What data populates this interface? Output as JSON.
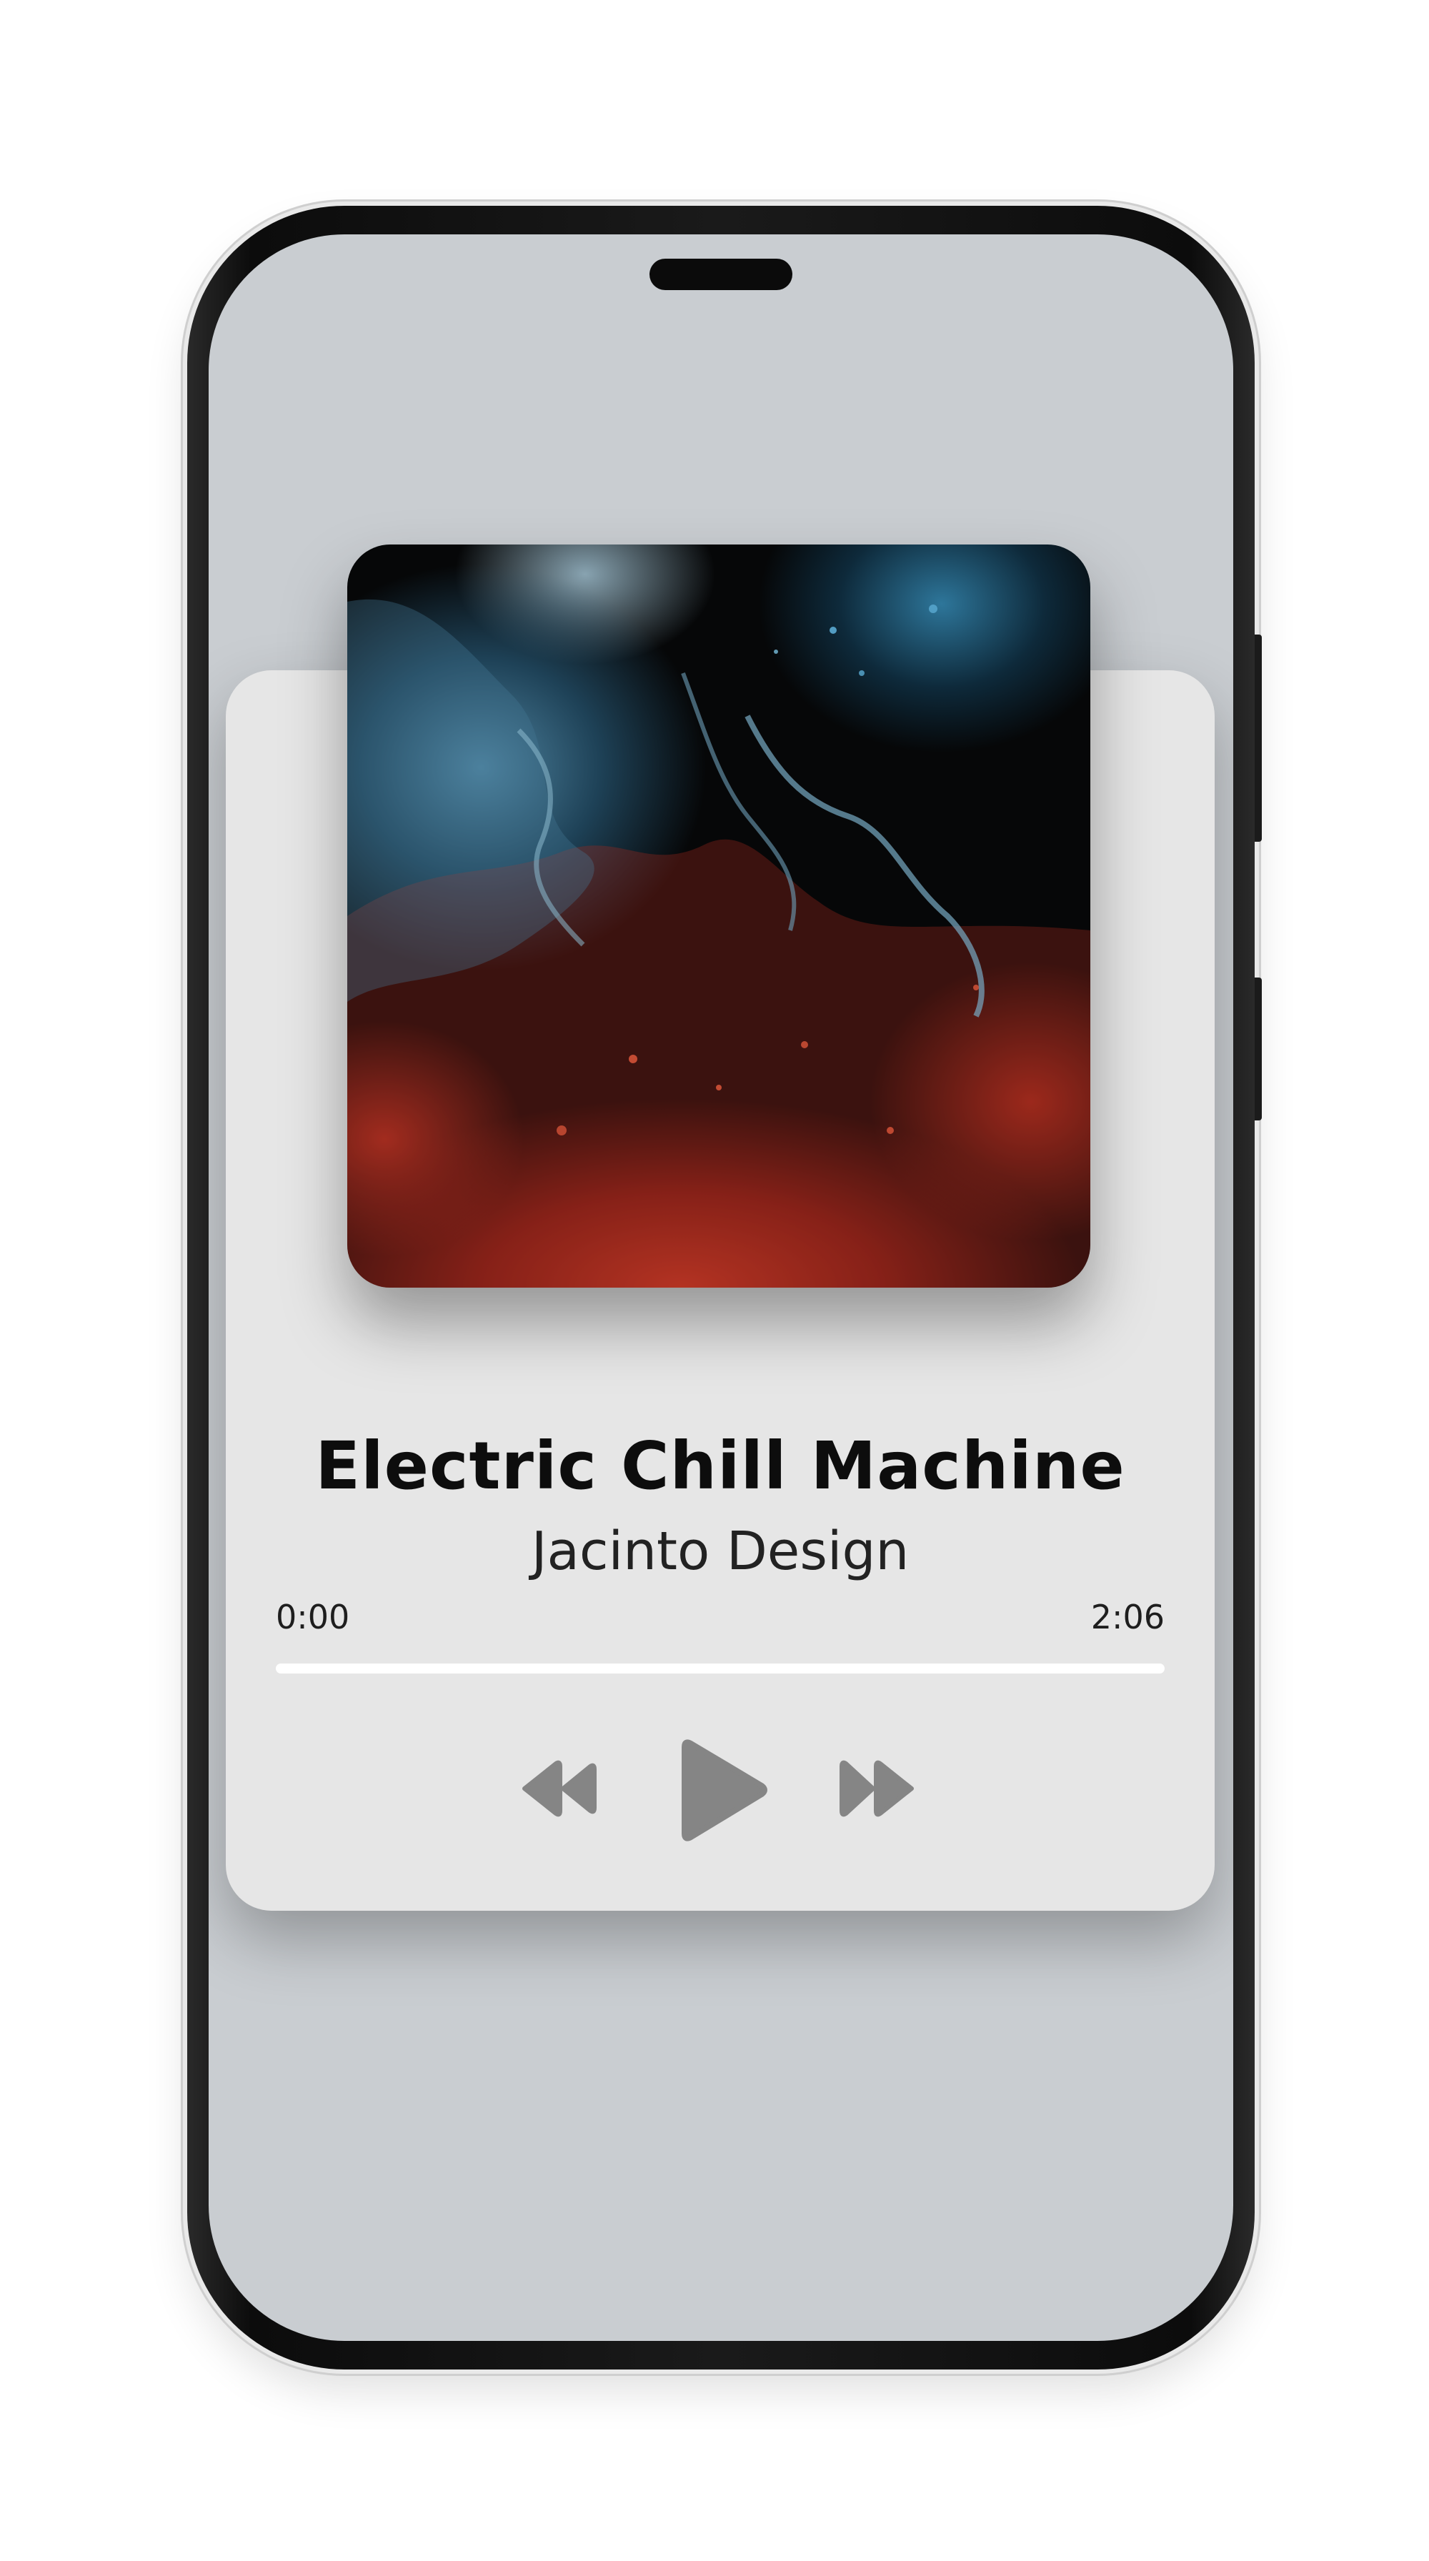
{
  "player": {
    "track_title": "Electric Chill Machine",
    "artist": "Jacinto Design",
    "current_time": "0:00",
    "duration": "2:06",
    "progress": 0,
    "controls": {
      "rewind_icon": "rewind-icon",
      "play_icon": "play-icon",
      "fast_forward_icon": "fast-forward-icon"
    },
    "colors": {
      "card": "#e6e6e6",
      "screen": "#c9cdd1",
      "icons": "#858585",
      "title": "#0d0d0d"
    }
  }
}
